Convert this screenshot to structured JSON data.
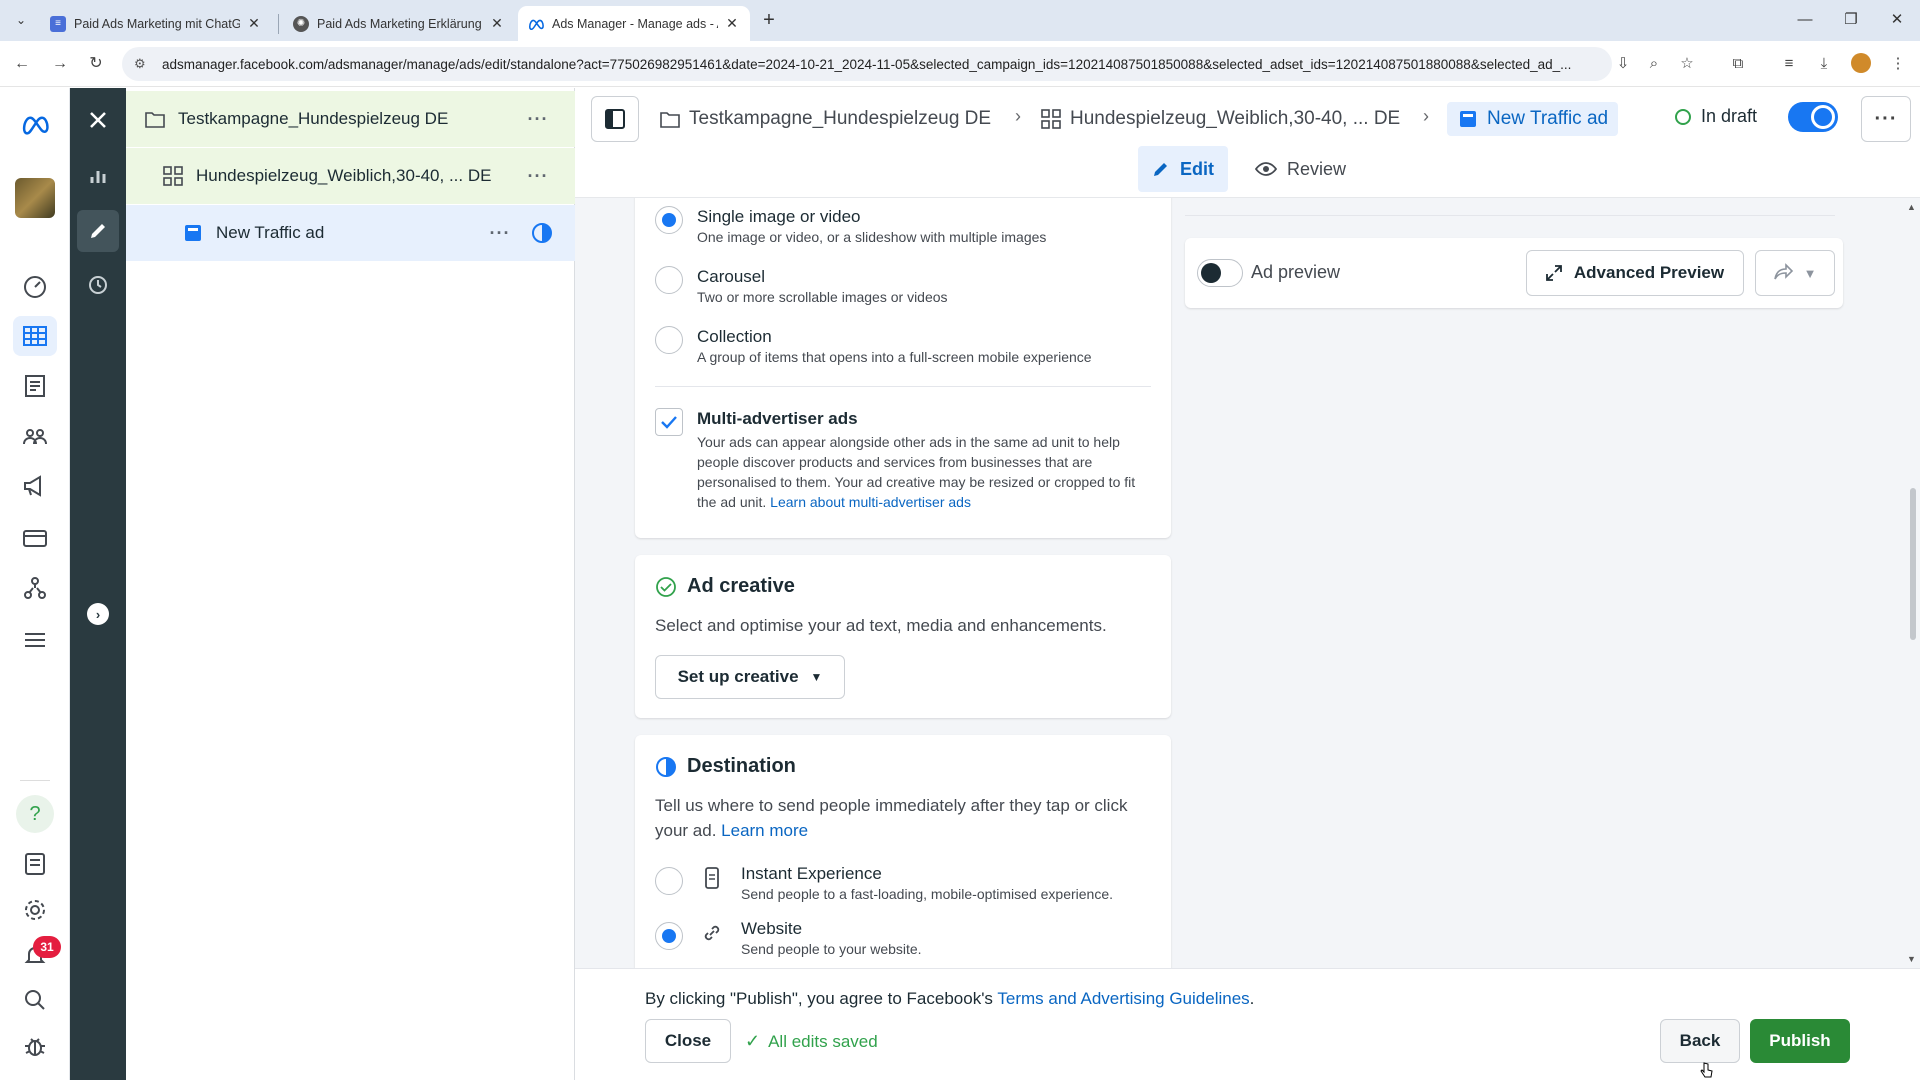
{
  "browser": {
    "tabs": [
      {
        "title": "Paid Ads Marketing mit ChatGPT",
        "favicon": "doc-icon",
        "active": false
      },
      {
        "title": "Paid Ads Marketing Erklärung",
        "favicon": "openai-icon",
        "active": false
      },
      {
        "title": "Ads Manager - Manage ads - A",
        "favicon": "meta-icon",
        "active": true
      }
    ],
    "url": "adsmanager.facebook.com/adsmanager/manage/ads/edit/standalone?act=775026982951461&date=2024-10-21_2024-11-05&selected_campaign_ids=120214087501850088&selected_adset_ids=120214087501880088&selected_ad_..."
  },
  "rail": {
    "notification_count": "31"
  },
  "tree": {
    "campaign": "Testkampagne_Hundespielzeug DE",
    "adset": "Hundespielzeug_Weiblich,30-40, ... DE",
    "ad": "New Traffic ad"
  },
  "header": {
    "breadcrumb": [
      "Testkampagne_Hundespielzeug DE",
      "Hundespielzeug_Weiblich,30-40, ... DE",
      "New Traffic ad"
    ],
    "status": "In draft",
    "edit_label": "Edit",
    "review_label": "Review"
  },
  "format": {
    "options": [
      {
        "label": "Single image or video",
        "desc": "One image or video, or a slideshow with multiple images",
        "selected": true
      },
      {
        "label": "Carousel",
        "desc": "Two or more scrollable images or videos",
        "selected": false
      },
      {
        "label": "Collection",
        "desc": "A group of items that opens into a full-screen mobile experience",
        "selected": false
      }
    ],
    "multi_advertiser": {
      "label": "Multi-advertiser ads",
      "desc": "Your ads can appear alongside other ads in the same ad unit to help people discover products and services from businesses that are personalised to them. Your ad creative may be resized or cropped to fit the ad unit. ",
      "link": "Learn about multi-advertiser ads",
      "checked": true
    }
  },
  "ad_creative": {
    "title": "Ad creative",
    "desc": "Select and optimise your ad text, media and enhancements.",
    "button": "Set up creative"
  },
  "destination": {
    "title": "Destination",
    "desc": "Tell us where to send people immediately after they tap or click your ad. ",
    "link": "Learn more",
    "options": [
      {
        "label": "Instant Experience",
        "desc": "Send people to a fast-loading, mobile-optimised experience.",
        "selected": false,
        "icon": "phone-icon"
      },
      {
        "label": "Website",
        "desc": "Send people to your website.",
        "selected": true,
        "icon": "link-icon"
      }
    ]
  },
  "preview": {
    "label": "Ad preview",
    "advanced_button": "Advanced Preview"
  },
  "footer": {
    "terms_prefix": "By clicking \"Publish\", you agree to Facebook's ",
    "terms_link": "Terms and Advertising Guidelines",
    "terms_suffix": ".",
    "close": "Close",
    "saved": "All edits saved",
    "back": "Back",
    "publish": "Publish"
  },
  "colors": {
    "accent": "#1877f2",
    "publish": "#2a8a36",
    "success": "#31a24c",
    "strip": "#2a3a40"
  }
}
